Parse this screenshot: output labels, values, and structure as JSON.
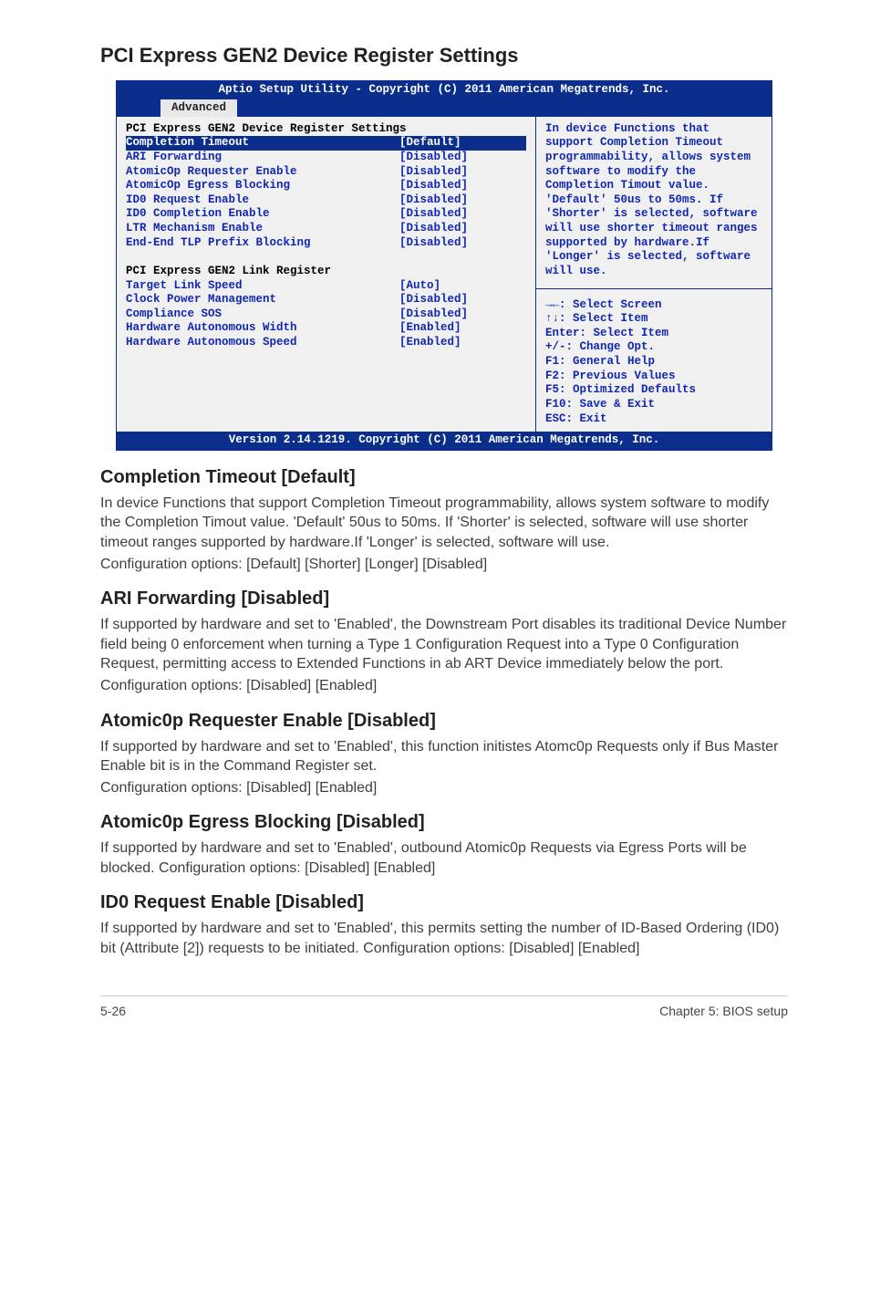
{
  "page_title": "PCI Express GEN2 Device Register Settings",
  "bios": {
    "top_title": "Aptio Setup Utility - Copyright (C) 2011 American Megatrends, Inc.",
    "tab": "Advanced",
    "section1_header": "PCI Express GEN2 Device Register Settings",
    "rows1": [
      {
        "label": "Completion Timeout",
        "value": "[Default]",
        "hl": true
      },
      {
        "label": "ARI Forwarding",
        "value": "[Disabled]",
        "hl": false
      },
      {
        "label": "AtomicOp Requester Enable",
        "value": "[Disabled]",
        "hl": false
      },
      {
        "label": "AtomicOp Egress Blocking",
        "value": "[Disabled]",
        "hl": false
      },
      {
        "label": "ID0 Request Enable",
        "value": "[Disabled]",
        "hl": false
      },
      {
        "label": "ID0 Completion Enable",
        "value": "[Disabled]",
        "hl": false
      },
      {
        "label": "LTR Mechanism Enable",
        "value": "[Disabled]",
        "hl": false
      },
      {
        "label": "End-End TLP Prefix Blocking",
        "value": "[Disabled]",
        "hl": false
      }
    ],
    "section2_header": "PCI Express GEN2 Link Register",
    "rows2": [
      {
        "label": "Target Link Speed",
        "value": "[Auto]",
        "hl": false
      },
      {
        "label": "Clock Power Management",
        "value": "[Disabled]",
        "hl": false
      },
      {
        "label": "Compliance SOS",
        "value": "[Disabled]",
        "hl": false
      },
      {
        "label": "Hardware Autonomous Width",
        "value": "[Enabled]",
        "hl": false
      },
      {
        "label": "Hardware Autonomous Speed",
        "value": "[Enabled]",
        "hl": false
      }
    ],
    "help_text": "In device Functions that support Completion Timeout programmability, allows system software to modify the Completion Timout value. 'Default' 50us to 50ms. If 'Shorter' is selected, software will use shorter timeout ranges supported by hardware.If 'Longer' is selected, software will use.",
    "nav": [
      "→←: Select Screen",
      "↑↓:  Select Item",
      "Enter: Select Item",
      "+/-: Change Opt.",
      "F1: General Help",
      "F2: Previous Values",
      "F5: Optimized Defaults",
      "F10: Save & Exit",
      "ESC: Exit"
    ],
    "footer": "Version 2.14.1219. Copyright (C) 2011 American Megatrends, Inc."
  },
  "sections": [
    {
      "heading": "Completion Timeout [Default]",
      "paras": [
        "In device Functions that support Completion Timeout programmability, allows system software to modify the Completion Timout value. 'Default' 50us to 50ms. If 'Shorter' is selected, software will use shorter timeout ranges supported by hardware.If 'Longer' is selected, software will use.",
        "Configuration options: [Default] [Shorter] [Longer] [Disabled]"
      ]
    },
    {
      "heading": "ARI Forwarding [Disabled]",
      "paras": [
        "If supported by hardware and set to 'Enabled', the Downstream Port disables its traditional Device Number field being 0 enforcement when turning a Type 1 Configuration Request into a Type 0 Configuration Request, permitting access to Extended Functions in ab ART Device immediately below the port.",
        "Configuration options: [Disabled] [Enabled]"
      ]
    },
    {
      "heading": "Atomic0p Requester Enable [Disabled]",
      "paras": [
        "If supported by hardware and set to 'Enabled', this function initistes Atomc0p Requests only if Bus Master Enable bit is in the Command Register set.",
        "Configuration options: [Disabled] [Enabled]"
      ]
    },
    {
      "heading": "Atomic0p Egress Blocking [Disabled]",
      "paras": [
        "If supported by hardware and set to 'Enabled', outbound Atomic0p Requests via Egress Ports will be blocked. Configuration options: [Disabled] [Enabled]"
      ]
    },
    {
      "heading": "ID0 Request Enable [Disabled]",
      "paras": [
        "If supported by hardware and set to 'Enabled', this permits setting the number of ID-Based Ordering (ID0) bit (Attribute [2]) requests to be initiated. Configuration options: [Disabled] [Enabled]"
      ]
    }
  ],
  "footer": {
    "left": "5-26",
    "right": "Chapter 5: BIOS setup"
  }
}
